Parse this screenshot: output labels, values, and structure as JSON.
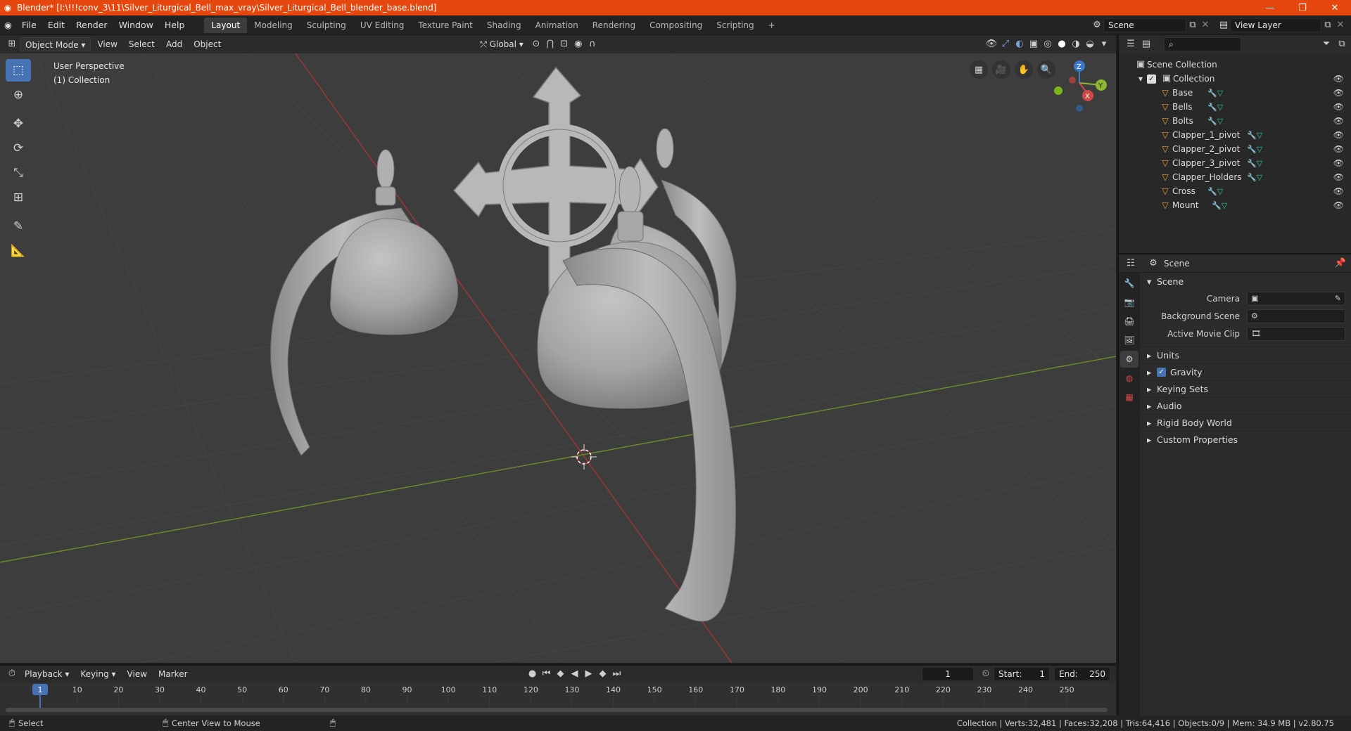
{
  "titlebar": {
    "title": "Blender* [I:\\!!!conv_3\\11\\Silver_Liturgical_Bell_max_vray\\Silver_Liturgical_Bell_blender_base.blend]",
    "minimize": "—",
    "maximize": "❐",
    "close": "✕"
  },
  "menu": [
    "File",
    "Edit",
    "Render",
    "Window",
    "Help"
  ],
  "workspaces": [
    "Layout",
    "Modeling",
    "Sculpting",
    "UV Editing",
    "Texture Paint",
    "Shading",
    "Animation",
    "Rendering",
    "Compositing",
    "Scripting"
  ],
  "active_workspace": "Layout",
  "scene_field": "Scene",
  "view_layer_field": "View Layer",
  "viewport_header": {
    "mode": "Object Mode",
    "view": "View",
    "select": "Select",
    "add": "Add",
    "object": "Object",
    "orientation": "Global"
  },
  "viewport": {
    "perspective_label": "User Perspective",
    "collection_label": "(1) Collection",
    "gizmo_labels": {
      "z": "Z",
      "y": "Y",
      "x": "X"
    }
  },
  "outliner": {
    "root": "Scene Collection",
    "collection": "Collection",
    "objects": [
      "Base",
      "Bells",
      "Bolts",
      "Clapper_1_pivot",
      "Clapper_2_pivot",
      "Clapper_3_pivot",
      "Clapper_Holders",
      "Cross",
      "Mount"
    ]
  },
  "properties": {
    "context": "Scene",
    "panel_title": "Scene",
    "camera_label": "Camera",
    "background_scene_label": "Background Scene",
    "active_movie_clip_label": "Active Movie Clip",
    "sub_panels": [
      "Units",
      "Gravity",
      "Keying Sets",
      "Audio",
      "Rigid Body World",
      "Custom Properties"
    ]
  },
  "timeline": {
    "playback": "Playback",
    "keying": "Keying",
    "view": "View",
    "marker": "Marker",
    "current_frame": "1",
    "start_label": "Start:",
    "start": "1",
    "end_label": "End:",
    "end": "250",
    "ticks": [
      "1",
      "10",
      "20",
      "30",
      "40",
      "50",
      "60",
      "70",
      "80",
      "90",
      "100",
      "110",
      "120",
      "130",
      "140",
      "150",
      "160",
      "170",
      "180",
      "190",
      "200",
      "210",
      "220",
      "230",
      "240",
      "250"
    ]
  },
  "statusbar": {
    "select": "Select",
    "center_view": "Center View to Mouse",
    "stats": "Collection | Verts:32,481 | Faces:32,208 | Tris:64,416 | Objects:0/9 | Mem: 34.9 MB | v2.80.75"
  }
}
